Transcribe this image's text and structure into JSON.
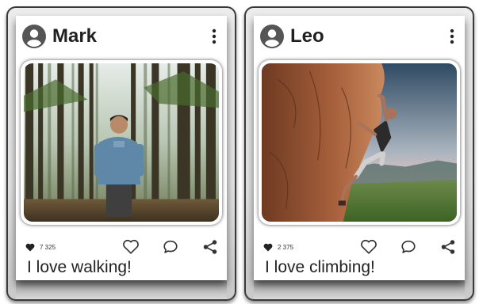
{
  "posts": [
    {
      "username": "Mark",
      "like_count": "7 325",
      "caption": "I love walking!",
      "photo_subject": "hiker in pine forest"
    },
    {
      "username": "Leo",
      "like_count": "2 375",
      "caption": "I love climbing!",
      "photo_subject": "climber on red rock cliff"
    }
  ],
  "colors": {
    "text": "#202020",
    "icon": "#333333",
    "card_border": "#3a3a3a"
  },
  "icons": [
    "user-avatar-icon",
    "more-vertical-icon",
    "heart-filled-icon",
    "heart-outline-icon",
    "comment-icon",
    "share-icon"
  ]
}
